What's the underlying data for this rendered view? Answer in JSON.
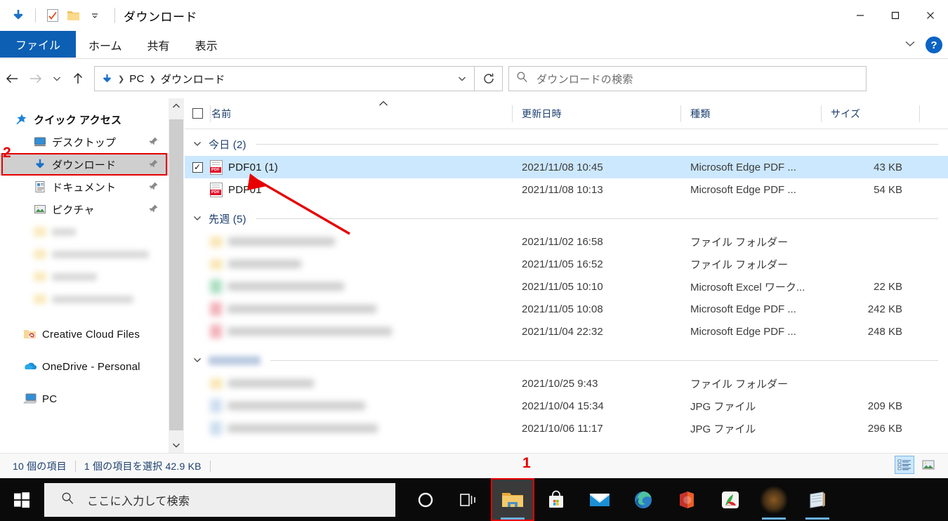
{
  "window": {
    "title": "ダウンロード",
    "quick_access_icons": [
      "download-arrow-icon",
      "checkmark-document-icon",
      "folder-icon",
      "customize-dropdown-icon"
    ],
    "controls": {
      "minimize": "—",
      "maximize": "☐",
      "close": "✕"
    }
  },
  "ribbon": {
    "tabs": [
      {
        "label": "ファイル",
        "active": true
      },
      {
        "label": "ホーム",
        "active": false
      },
      {
        "label": "共有",
        "active": false
      },
      {
        "label": "表示",
        "active": false
      }
    ],
    "collapse_icon": "chevron-down-icon",
    "help_label": "?"
  },
  "navbar": {
    "back_icon": "back-arrow-icon",
    "forward_icon": "forward-arrow-icon",
    "recent_icon": "chevron-down-icon",
    "up_icon": "up-arrow-icon",
    "breadcrumb": [
      "PC",
      "ダウンロード"
    ],
    "breadcrumb_icon": "download-arrow-icon",
    "address_dropdown_icon": "chevron-down-icon",
    "refresh_icon": "refresh-icon",
    "search": {
      "icon": "search-icon",
      "placeholder": "ダウンロードの検索",
      "value": ""
    }
  },
  "sidebar": {
    "items": [
      {
        "label": "クイック アクセス",
        "icon": "star-pin-icon",
        "kind": "header",
        "pinned": false,
        "selected": false
      },
      {
        "label": "デスクトップ",
        "icon": "desktop-icon",
        "kind": "child",
        "pinned": true,
        "selected": false
      },
      {
        "label": "ダウンロード",
        "icon": "download-arrow-icon",
        "kind": "child",
        "pinned": true,
        "selected": true
      },
      {
        "label": "ドキュメント",
        "icon": "document-icon",
        "kind": "child",
        "pinned": true,
        "selected": false
      },
      {
        "label": "ピクチャ",
        "icon": "picture-icon",
        "kind": "child",
        "pinned": true,
        "selected": false
      },
      {
        "label": "",
        "icon": "folder-icon",
        "kind": "blurred",
        "pinned": false,
        "selected": false
      },
      {
        "label": "",
        "icon": "folder-icon",
        "kind": "blurred",
        "pinned": false,
        "selected": false
      },
      {
        "label": "",
        "icon": "folder-icon",
        "kind": "blurred",
        "pinned": false,
        "selected": false
      },
      {
        "label": "",
        "icon": "folder-icon",
        "kind": "blurred",
        "pinned": false,
        "selected": false
      },
      {
        "label": "Creative Cloud Files",
        "icon": "creative-cloud-folder-icon",
        "kind": "root",
        "pinned": false,
        "selected": false
      },
      {
        "label": "OneDrive - Personal",
        "icon": "onedrive-cloud-icon",
        "kind": "root",
        "pinned": false,
        "selected": false
      },
      {
        "label": "PC",
        "icon": "this-pc-icon",
        "kind": "root",
        "pinned": false,
        "selected": false
      }
    ],
    "scrollbar": {
      "up_icon": "chevron-up-icon",
      "down_icon": "chevron-down-icon"
    }
  },
  "filelist": {
    "columns": [
      {
        "label": "名前",
        "sorted": "asc"
      },
      {
        "label": "更新日時",
        "sorted": ""
      },
      {
        "label": "種類",
        "sorted": ""
      },
      {
        "label": "サイズ",
        "sorted": ""
      }
    ],
    "select_all_checkbox": false,
    "sort_caret_icon": "caret-up-icon",
    "groups": [
      {
        "name": "今日 (2)",
        "blurred_name": false,
        "collapse_icon": "chevron-down-icon",
        "rows": [
          {
            "name": "PDF01 (1)",
            "icon": "pdf-file-icon",
            "date": "2021/11/08 10:45",
            "type": "Microsoft Edge PDF ...",
            "size": "43 KB",
            "selected": true,
            "checked": true,
            "blurred": false
          },
          {
            "name": "PDF01",
            "icon": "pdf-file-icon",
            "date": "2021/11/08 10:13",
            "type": "Microsoft Edge PDF ...",
            "size": "54 KB",
            "selected": false,
            "checked": false,
            "blurred": false
          }
        ]
      },
      {
        "name": "先週 (5)",
        "blurred_name": false,
        "collapse_icon": "chevron-down-icon",
        "rows": [
          {
            "name": "",
            "icon": "folder-icon",
            "date": "2021/11/02 16:58",
            "type": "ファイル フォルダー",
            "size": "",
            "selected": false,
            "checked": false,
            "blurred": true
          },
          {
            "name": "",
            "icon": "folder-icon",
            "date": "2021/11/05 16:52",
            "type": "ファイル フォルダー",
            "size": "",
            "selected": false,
            "checked": false,
            "blurred": true
          },
          {
            "name": "",
            "icon": "excel-file-icon",
            "date": "2021/11/05 10:10",
            "type": "Microsoft Excel ワーク...",
            "size": "22 KB",
            "selected": false,
            "checked": false,
            "blurred": true
          },
          {
            "name": "",
            "icon": "pdf-file-icon",
            "date": "2021/11/05 10:08",
            "type": "Microsoft Edge PDF ...",
            "size": "242 KB",
            "selected": false,
            "checked": false,
            "blurred": true
          },
          {
            "name": "",
            "icon": "pdf-file-icon",
            "date": "2021/11/04 22:32",
            "type": "Microsoft Edge PDF ...",
            "size": "248 KB",
            "selected": false,
            "checked": false,
            "blurred": true
          }
        ]
      },
      {
        "name": "",
        "blurred_name": true,
        "collapse_icon": "chevron-down-icon",
        "rows": [
          {
            "name": "",
            "icon": "folder-icon",
            "date": "2021/10/25 9:43",
            "type": "ファイル フォルダー",
            "size": "",
            "selected": false,
            "checked": false,
            "blurred": true
          },
          {
            "name": "",
            "icon": "jpg-file-icon",
            "date": "2021/10/04 15:34",
            "type": "JPG ファイル",
            "size": "209 KB",
            "selected": false,
            "checked": false,
            "blurred": true
          },
          {
            "name": "",
            "icon": "jpg-file-icon",
            "date": "2021/10/06 11:17",
            "type": "JPG ファイル",
            "size": "296 KB",
            "selected": false,
            "checked": false,
            "blurred": true
          }
        ]
      }
    ]
  },
  "statusbar": {
    "item_count": "10 個の項目",
    "selection": "1 個の項目を選択  42.9 KB",
    "views": [
      {
        "name": "details-view",
        "active": true
      },
      {
        "name": "large-icons-view",
        "active": false
      }
    ]
  },
  "taskbar": {
    "start_icon": "windows-logo-icon",
    "search": {
      "icon": "search-icon",
      "placeholder": "ここに入力して検索",
      "value": ""
    },
    "items": [
      {
        "name": "cortana",
        "icon": "cortana-circle-icon",
        "running": false,
        "highlighted": false
      },
      {
        "name": "task-view",
        "icon": "task-view-icon",
        "running": false,
        "highlighted": false
      },
      {
        "name": "file-explorer",
        "icon": "file-explorer-folder-icon",
        "running": true,
        "highlighted": true
      },
      {
        "name": "microsoft-store",
        "icon": "store-bag-icon",
        "running": false,
        "highlighted": false
      },
      {
        "name": "mail",
        "icon": "mail-envelope-icon",
        "running": false,
        "highlighted": false
      },
      {
        "name": "microsoft-edge",
        "icon": "edge-swirl-icon",
        "running": false,
        "highlighted": false
      },
      {
        "name": "microsoft-office",
        "icon": "office-icon",
        "running": false,
        "highlighted": false
      },
      {
        "name": "acrobat-like-app",
        "icon": "green-red-app-icon",
        "running": false,
        "highlighted": false
      },
      {
        "name": "glow-app",
        "icon": "orange-glow-icon",
        "running": true,
        "highlighted": false
      },
      {
        "name": "notepad-app",
        "icon": "notepad-icon",
        "running": true,
        "highlighted": false
      }
    ]
  },
  "annotations": [
    {
      "label": "1",
      "target": "file-explorer-taskbar-button",
      "color": "#e60000"
    },
    {
      "label": "2",
      "target": "sidebar-item-downloads",
      "color": "#e60000"
    },
    {
      "label": "arrow",
      "target": "file-row-pdf01-1",
      "color": "#e60000"
    }
  ]
}
